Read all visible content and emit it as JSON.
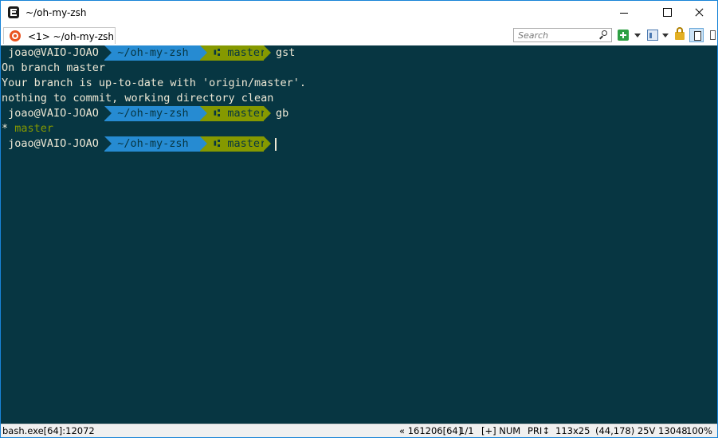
{
  "window": {
    "title": "~/oh-my-zsh"
  },
  "tabs": [
    {
      "label": "<1> ~/oh-my-zsh",
      "icon": "ubuntu-icon"
    }
  ],
  "toolbar": {
    "search_placeholder": "Search",
    "icons": [
      "plus-icon",
      "chevron-down-icon",
      "panel-icon",
      "chevron-down-icon",
      "lock-icon",
      "split-view-icon",
      "menu-icon"
    ]
  },
  "terminal": {
    "colors": {
      "background": "#073642",
      "foreground": "#eee8d5",
      "dir_segment": "#268bd2",
      "git_segment": "#859900"
    },
    "prompt": {
      "user_host": "joao@VAIO-JOAO",
      "directory": "~/oh-my-zsh",
      "branch_glyph": "⑆",
      "branch": "master"
    },
    "commands": [
      "gst",
      "gb"
    ],
    "output": [
      "On branch master",
      "Your branch is up-to-date with 'origin/master'.",
      "nothing to commit, working directory clean"
    ],
    "branch_list": {
      "marker": "*",
      "name": "master"
    }
  },
  "statusbar": {
    "process": "bash.exe[64]:12072",
    "console_info": "« 161206[64]",
    "position": "1/1",
    "mode": "[+] NUM",
    "priority": "PRI↕",
    "size": "113x25",
    "cursor": "(44,178) 25V",
    "pid": "13048",
    "zoom": "100%"
  }
}
